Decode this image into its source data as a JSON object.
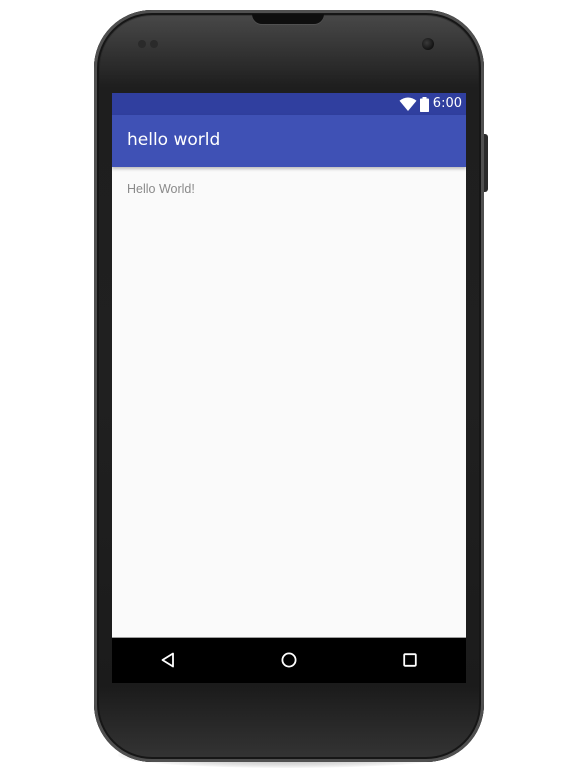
{
  "status_bar": {
    "time": "6:00",
    "icons": [
      "wifi-icon",
      "battery-icon"
    ],
    "color": "#303f9f"
  },
  "app_bar": {
    "title": "hello world",
    "color": "#3f51b5"
  },
  "content": {
    "text": "Hello World!"
  },
  "nav_bar": {
    "buttons": [
      "back-icon",
      "home-icon",
      "recents-icon"
    ]
  },
  "device": {
    "frame": "phone"
  }
}
